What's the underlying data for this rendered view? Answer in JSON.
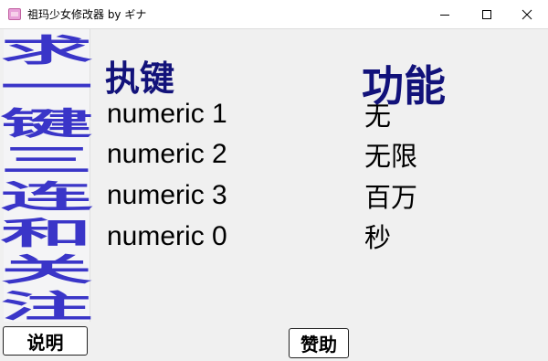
{
  "window": {
    "title": "祖玛少女修改器 by ギナ",
    "app_icon": "app-icon",
    "controls": [
      "minimize-icon",
      "maximize-icon",
      "close-icon"
    ]
  },
  "sidebar": {
    "text": [
      "求",
      "一",
      "键",
      "三",
      "连",
      "和",
      "关",
      "注"
    ],
    "color": "#3a35c8"
  },
  "table": {
    "hotkey_header": "执键",
    "function_header": "功能",
    "header_color": "#12127a",
    "rows": [
      {
        "key": "numeric 1",
        "function": "无"
      },
      {
        "key": "numeric 2",
        "function": "无限"
      },
      {
        "key": "numeric 3",
        "function": "百万"
      },
      {
        "key": "numeric 0",
        "function": "秒"
      }
    ]
  },
  "buttons": {
    "description": "说明",
    "sponsor": "赞助"
  }
}
